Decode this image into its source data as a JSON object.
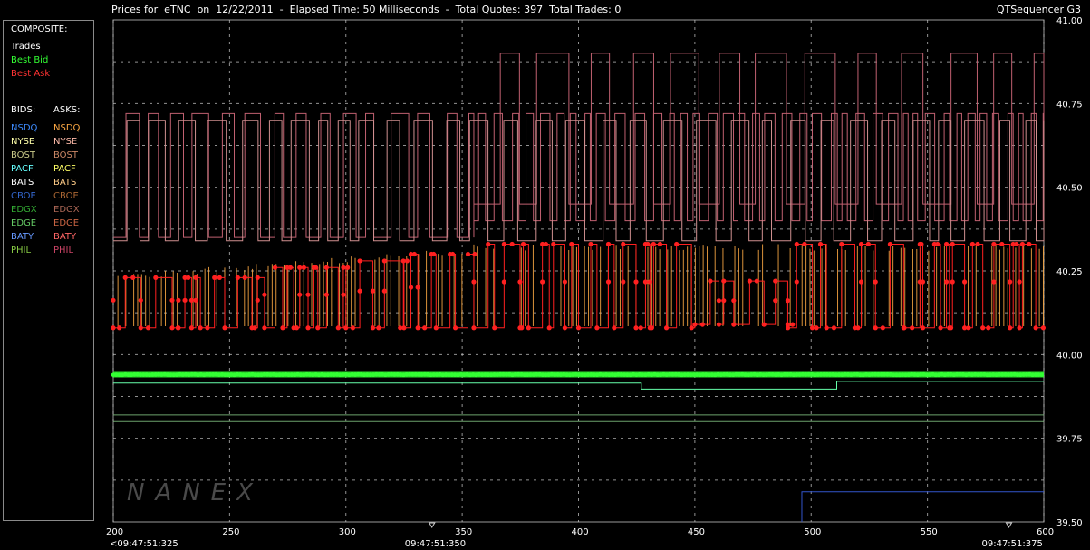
{
  "header": {
    "title": "Prices for  eTNC  on  12/22/2011  -  Elapsed Time: 50 Milliseconds  -  Total Quotes: 397  Total Trades: 0",
    "app_name": "QTSequencer G3"
  },
  "legend": {
    "composite_label": "COMPOSITE:",
    "composite_items": [
      {
        "label": "Trades",
        "color": "#ffffff"
      },
      {
        "label": "Best Bid",
        "color": "#33ff33"
      },
      {
        "label": "Best Ask",
        "color": "#ff3333"
      }
    ],
    "bids_header": "BIDS:",
    "asks_header": "ASKS:",
    "bids": [
      {
        "label": "NSDQ",
        "color": "#3d8bff"
      },
      {
        "label": "NYSE",
        "color": "#ffffaa"
      },
      {
        "label": "BOST",
        "color": "#c8c888"
      },
      {
        "label": "PACF",
        "color": "#66ffff"
      },
      {
        "label": "BATS",
        "color": "#ffffff"
      },
      {
        "label": "CBOE",
        "color": "#3366cc"
      },
      {
        "label": "EDGX",
        "color": "#33aa33"
      },
      {
        "label": "EDGE",
        "color": "#66cc66"
      },
      {
        "label": "BATY",
        "color": "#6699ff"
      },
      {
        "label": "PHIL",
        "color": "#88cc44"
      }
    ],
    "asks": [
      {
        "label": "NSDQ",
        "color": "#ffaa44"
      },
      {
        "label": "NYSE",
        "color": "#ffbbaa"
      },
      {
        "label": "BOST",
        "color": "#cc8866"
      },
      {
        "label": "PACF",
        "color": "#ffff66"
      },
      {
        "label": "BATS",
        "color": "#ffcc88"
      },
      {
        "label": "CBOE",
        "color": "#aa6633"
      },
      {
        "label": "EDGX",
        "color": "#aa6655"
      },
      {
        "label": "EDGE",
        "color": "#cc6644"
      },
      {
        "label": "BATY",
        "color": "#ff6666"
      },
      {
        "label": "PHIL",
        "color": "#cc4466"
      }
    ]
  },
  "watermark": "NANEX",
  "chart_data": {
    "type": "line",
    "title": "",
    "xlabel": "",
    "ylabel": "",
    "xlim": [
      200,
      600
    ],
    "ylim": [
      39.5,
      41.0
    ],
    "grid": true,
    "x_ticks": [
      200,
      250,
      300,
      350,
      400,
      450,
      500,
      550,
      600
    ],
    "y_ticks": [
      39.5,
      39.75,
      40.0,
      40.25,
      40.5,
      40.75,
      41.0
    ],
    "y_tick_labels": [
      "39.50",
      "39.75",
      "40.00",
      "40.25",
      "40.50",
      "40.75",
      "41.00"
    ],
    "time_labels": [
      {
        "x": 200,
        "label": "<09:47:51:325"
      },
      {
        "x": 337,
        "label": "09:47:51:350"
      },
      {
        "x": 585,
        "label": "09:47:51:375"
      }
    ],
    "colors": {
      "grid": "#d0d0d0",
      "best_bid": "#33ff33",
      "best_ask": "#ff2020",
      "ask_upper": "#c06070",
      "ask_mid": "#d09090",
      "ask_nsdq": "#ffaa44",
      "bid_flat": "#66ffaa",
      "cboe_bid": "#3355cc"
    },
    "series": [
      {
        "name": "Best Ask",
        "color": "#ff2020",
        "steps": [
          {
            "from": 200,
            "to": 228,
            "low": 40.08,
            "high": 40.23
          },
          {
            "from": 228,
            "to": 265,
            "low": 40.08,
            "high": 40.23
          },
          {
            "from": 265,
            "to": 300,
            "low": 40.08,
            "high": 40.26
          },
          {
            "from": 300,
            "to": 325,
            "low": 40.08,
            "high": 40.28
          },
          {
            "from": 325,
            "to": 355,
            "low": 40.08,
            "high": 40.3
          },
          {
            "from": 355,
            "to": 400,
            "low": 40.08,
            "high": 40.33
          },
          {
            "from": 400,
            "to": 450,
            "low": 40.08,
            "high": 40.33
          },
          {
            "from": 450,
            "to": 490,
            "low": 40.09,
            "high": 40.22
          },
          {
            "from": 490,
            "to": 540,
            "low": 40.08,
            "high": 40.33
          },
          {
            "from": 540,
            "to": 600,
            "low": 40.08,
            "high": 40.33
          }
        ]
      },
      {
        "name": "Best Bid",
        "color": "#33ff33",
        "value": 39.94
      }
    ]
  }
}
